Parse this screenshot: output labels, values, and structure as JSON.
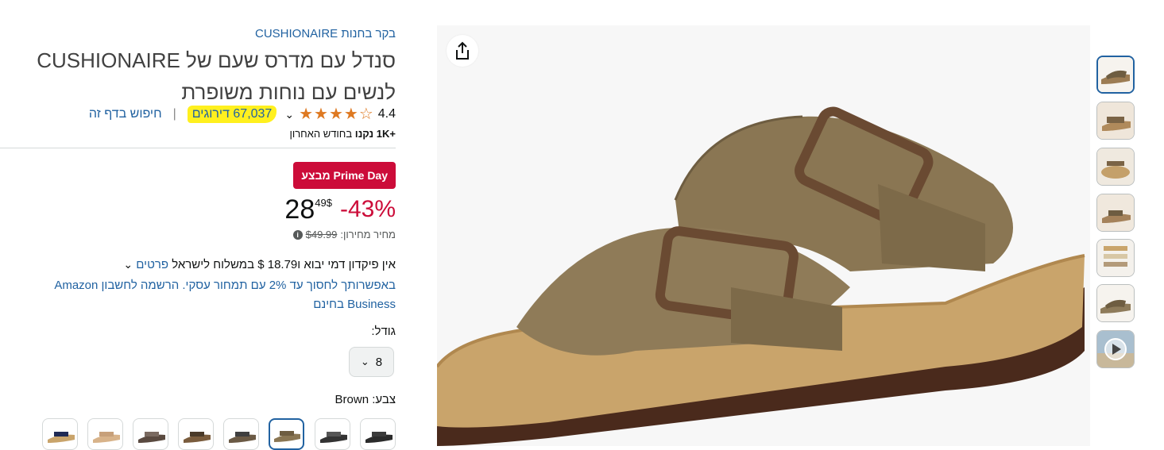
{
  "store": {
    "link_text": "בקר בחנות CUSHIONAIRE"
  },
  "product": {
    "title": "סנדל עם מדרס שעם של CUSHIONAIRE לנשים עם נוחות משופרת",
    "rating_value": "4.4",
    "rating_count_text": "67,037 דירוגים",
    "search_page_text": "חיפוש בדף זה",
    "bought_bold": "+1K",
    "bought_bold2": "נקנו",
    "bought_rest": "בחודש האחרון"
  },
  "deal": {
    "badge": "מבצע Prime Day"
  },
  "price": {
    "discount": "-43%",
    "currency": "$",
    "whole": "28",
    "fraction": "49",
    "list_label": "מחיר מחירון:",
    "list_value": "$49.99"
  },
  "shipping": {
    "text": "אין פיקדון דמי יבוא ו‎$ 18.79 במשלוח לישראל",
    "details_link": "פרטים"
  },
  "business": {
    "text": "באפשרותך לחסוך עד 2% עם תמחור עסקי. הרשמה לחשבון Amazon Business בחינם"
  },
  "size": {
    "label": "גודל:",
    "selected": "8"
  },
  "color": {
    "label": "צבע:",
    "selected": "Brown"
  },
  "colors": {
    "highlight": "#fff01f",
    "deal_red": "#cc0c39",
    "link_blue": "#2162a1",
    "star": "#de7921"
  },
  "icons": {
    "share": "share-icon",
    "dropdown": "chevron-down-icon",
    "info": "info-icon",
    "play": "play-icon"
  }
}
